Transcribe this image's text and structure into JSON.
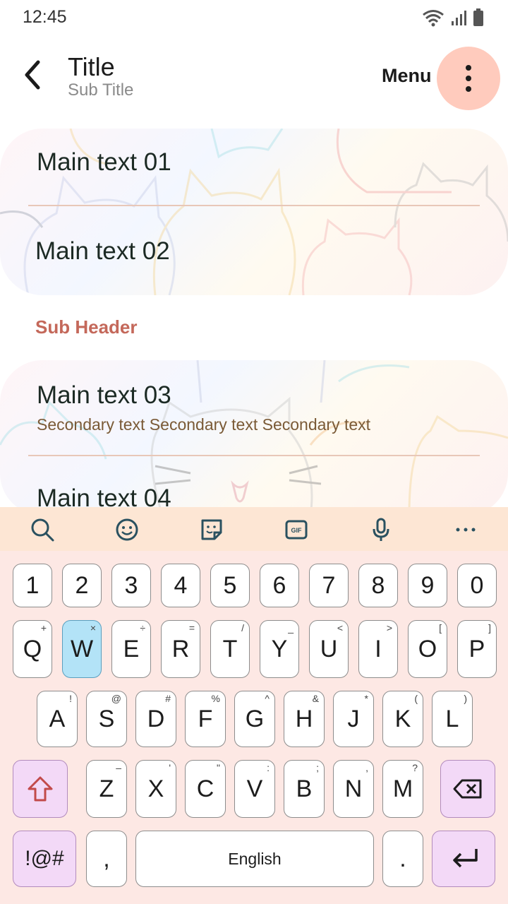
{
  "status": {
    "time": "12:45"
  },
  "appbar": {
    "title": "Title",
    "subtitle": "Sub Title",
    "menu_label": "Menu"
  },
  "list": {
    "item1": "Main text 01",
    "item2": "Main text 02",
    "subheader": "Sub Header",
    "item3": "Main text 03",
    "item3_secondary": "Secondary text Secondary text Secondary text",
    "item4": "Main text 04"
  },
  "keyboard": {
    "toolbar": [
      "search-icon",
      "emoji-icon",
      "sticker-icon",
      "gif-icon",
      "mic-icon",
      "more-icon"
    ],
    "gif_label": "GIF",
    "numbers": [
      "1",
      "2",
      "3",
      "4",
      "5",
      "6",
      "7",
      "8",
      "9",
      "0"
    ],
    "row1": [
      {
        "k": "Q",
        "h": "+"
      },
      {
        "k": "W",
        "h": "×"
      },
      {
        "k": "E",
        "h": "÷"
      },
      {
        "k": "R",
        "h": "="
      },
      {
        "k": "T",
        "h": "/"
      },
      {
        "k": "Y",
        "h": "_"
      },
      {
        "k": "U",
        "h": "<"
      },
      {
        "k": "I",
        "h": ">"
      },
      {
        "k": "O",
        "h": "["
      },
      {
        "k": "P",
        "h": "]"
      }
    ],
    "row2": [
      {
        "k": "A",
        "h": "!"
      },
      {
        "k": "S",
        "h": "@"
      },
      {
        "k": "D",
        "h": "#"
      },
      {
        "k": "F",
        "h": "%"
      },
      {
        "k": "G",
        "h": "^"
      },
      {
        "k": "H",
        "h": "&"
      },
      {
        "k": "J",
        "h": "*"
      },
      {
        "k": "K",
        "h": "("
      },
      {
        "k": "L",
        "h": ")"
      }
    ],
    "row3": [
      {
        "k": "Z",
        "h": "–"
      },
      {
        "k": "X",
        "h": "'"
      },
      {
        "k": "C",
        "h": "\""
      },
      {
        "k": "V",
        "h": ":"
      },
      {
        "k": "B",
        "h": ";"
      },
      {
        "k": "N",
        "h": ","
      },
      {
        "k": "M",
        "h": "?"
      }
    ],
    "symbols_label": "!@#",
    "comma": ",",
    "space_label": "English",
    "period": ".",
    "active_key": "W",
    "colors": {
      "accent": "#c4685a",
      "keyboard_bg": "#fde8e4",
      "func_key": "#f3d9f7",
      "active_key": "#b3e3f7"
    }
  }
}
